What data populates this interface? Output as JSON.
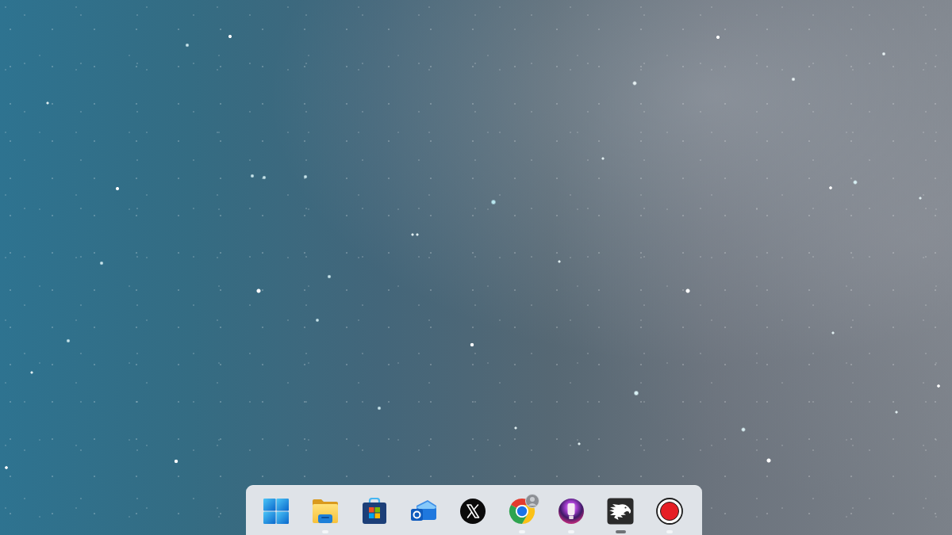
{
  "taskbar": {
    "items": [
      {
        "kind": "start",
        "running": false,
        "selected": false,
        "profile_badge": false
      },
      {
        "kind": "folder",
        "running": true,
        "selected": false,
        "profile_badge": false
      },
      {
        "kind": "store",
        "running": false,
        "selected": false,
        "profile_badge": false
      },
      {
        "kind": "mail",
        "running": false,
        "selected": false,
        "profile_badge": false
      },
      {
        "kind": "x",
        "running": false,
        "selected": false,
        "profile_badge": false
      },
      {
        "kind": "browser",
        "running": true,
        "selected": false,
        "profile_badge": true
      },
      {
        "kind": "lamp",
        "running": true,
        "selected": false,
        "profile_badge": false
      },
      {
        "kind": "eagle",
        "running": true,
        "selected": true,
        "profile_badge": false
      },
      {
        "kind": "record",
        "running": true,
        "selected": false,
        "profile_badge": false
      }
    ]
  }
}
